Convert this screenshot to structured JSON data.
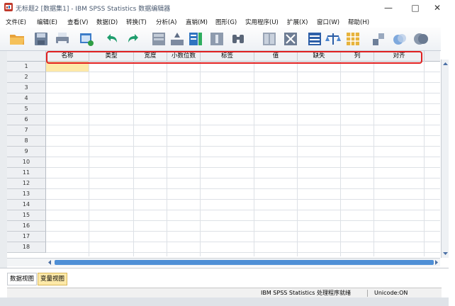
{
  "window": {
    "title": "无标题2 [数据集1] - IBM SPSS Statistics 数据编辑器",
    "minimize": "—",
    "maximize": "□",
    "close": "✕"
  },
  "menu": [
    "文件(E)",
    "编辑(E)",
    "查看(V)",
    "数据(D)",
    "转换(T)",
    "分析(A)",
    "直销(M)",
    "图形(G)",
    "实用程序(U)",
    "扩展(X)",
    "窗口(W)",
    "帮助(H)"
  ],
  "toolbar": [
    "open-folder-icon",
    "save-icon",
    "print-icon",
    "recall-dialog-icon",
    "undo-icon",
    "redo-icon",
    "goto-case-icon",
    "goto-variable-icon",
    "variables-icon",
    "insert-case-icon",
    "find-icon",
    "split-file-icon",
    "weight-cases-icon",
    "scale-icon",
    "select-cases-icon",
    "value-labels-icon",
    "use-sets-icon",
    "show-all-icon",
    "spelling-icon"
  ],
  "columns": [
    "名称",
    "类型",
    "宽度",
    "小数位数",
    "标签",
    "值",
    "缺失",
    "列",
    "对齐"
  ],
  "rows": [
    "1",
    "2",
    "3",
    "4",
    "5",
    "6",
    "7",
    "8",
    "9",
    "10",
    "11",
    "12",
    "13",
    "14",
    "15",
    "16",
    "17",
    "18"
  ],
  "tabs": {
    "data_view": "数据视图",
    "variable_view": "变量视图"
  },
  "status": {
    "processor": "IBM SPSS Statistics 处理程序就绪",
    "unicode": "Unicode:ON"
  },
  "colors": {
    "highlight": "#e02020",
    "active_tab": "#fde9a8",
    "selected_cell": "#fde9a8"
  }
}
